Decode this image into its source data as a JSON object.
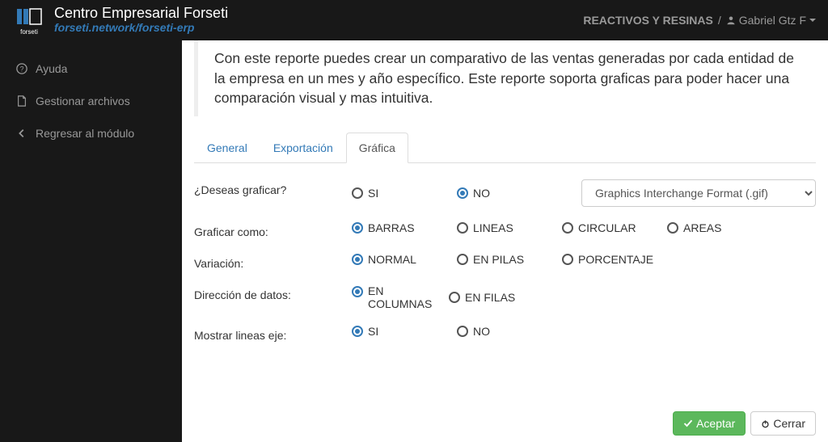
{
  "brand": {
    "title": "Centro Empresarial Forseti",
    "subtitle": "forseti.network/forseti-erp"
  },
  "header": {
    "company": "REACTIVOS Y RESINAS",
    "sep": "/",
    "user": "Gabriel Gtz F"
  },
  "sidebar": {
    "items": [
      {
        "label": "Ayuda"
      },
      {
        "label": "Gestionar archivos"
      },
      {
        "label": "Regresar al módulo"
      }
    ]
  },
  "report": {
    "description": "Con este reporte puedes crear un comparativo de las ventas generadas por cada entidad de la empresa en un mes y año específico. Este reporte soporta graficas para poder hacer una comparación visual y mas intuitiva."
  },
  "tabs": [
    {
      "label": "General"
    },
    {
      "label": "Exportación"
    },
    {
      "label": "Gráfica"
    }
  ],
  "form": {
    "q1": {
      "label": "¿Deseas graficar?",
      "opts": [
        "SI",
        "NO"
      ],
      "selected": "NO",
      "format_selected": "Graphics Interchange Format (.gif)"
    },
    "q2": {
      "label": "Graficar como:",
      "opts": [
        "BARRAS",
        "LINEAS",
        "CIRCULAR",
        "AREAS"
      ],
      "selected": "BARRAS"
    },
    "q3": {
      "label": "Variación:",
      "opts": [
        "NORMAL",
        "EN PILAS",
        "PORCENTAJE"
      ],
      "selected": "NORMAL"
    },
    "q4": {
      "label": "Dirección de datos:",
      "opts": [
        "EN COLUMNAS",
        "EN FILAS"
      ],
      "selected": "EN COLUMNAS"
    },
    "q5": {
      "label": "Mostrar lineas eje:",
      "opts": [
        "SI",
        "NO"
      ],
      "selected": "SI"
    }
  },
  "buttons": {
    "accept": "Aceptar",
    "close": "Cerrar"
  }
}
